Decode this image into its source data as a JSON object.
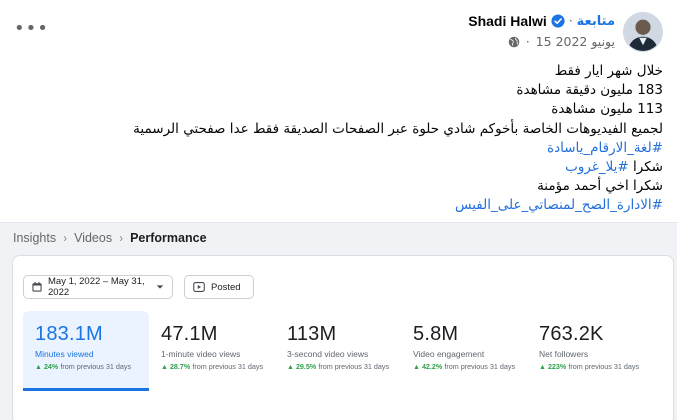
{
  "post": {
    "author": "Shadi Halwi",
    "follow_label": "متابعة",
    "separator": "·",
    "date": "15 يونيو 2022",
    "lines": [
      {
        "text": "خلال شهر ايار فقط",
        "hashtag": false
      },
      {
        "text": "183 مليون دقيقة مشاهدة",
        "hashtag": false
      },
      {
        "text": "113 مليون مشاهدة",
        "hashtag": false
      },
      {
        "text": "لجميع الفيديوهات الخاصة بأخوكم شادي حلوة عبر الصفحات الصديقة فقط عدا صفحتي الرسمية",
        "hashtag": false
      }
    ],
    "hashtag1": "#لغة_الارقام_ياسادة",
    "thanks_prefix": "شكرا ",
    "hashtag2": "#يلا_غروب",
    "line_thanks2": "شكرا اخي أحمد مؤمنة",
    "hashtag3": "#الادارة_الصح_لمنصاتي_على_الفيس"
  },
  "insights": {
    "breadcrumb": [
      "Insights",
      "Videos",
      "Performance"
    ],
    "date_range": "May 1, 2022 – May 31, 2022",
    "posted_label": "Posted",
    "metrics": [
      {
        "value": "183.1M",
        "label": "Minutes viewed",
        "pct": "24%",
        "suffix": "from previous 31 days"
      },
      {
        "value": "47.1M",
        "label": "1-minute video views",
        "pct": "28.7%",
        "suffix": "from previous 31 days"
      },
      {
        "value": "113M",
        "label": "3-second video views",
        "pct": "29.5%",
        "suffix": "from previous 31 days"
      },
      {
        "value": "5.8M",
        "label": "Video engagement",
        "pct": "42.2%",
        "suffix": "from previous 31 days"
      },
      {
        "value": "763.2K",
        "label": "Net followers",
        "pct": "223%",
        "suffix": "from previous 31 days"
      }
    ]
  },
  "icons": {
    "more": "more-icon",
    "verified": "verified-badge-icon",
    "globe": "globe-icon",
    "calendar": "calendar-icon",
    "dropdown": "chevron-down-icon",
    "video": "video-icon",
    "chevron": "chevron-right-icon",
    "trend": "arrow-up-icon"
  },
  "colors": {
    "accent": "#1b74e4",
    "positive": "#31a24c",
    "hashtag": "#216fdb"
  }
}
